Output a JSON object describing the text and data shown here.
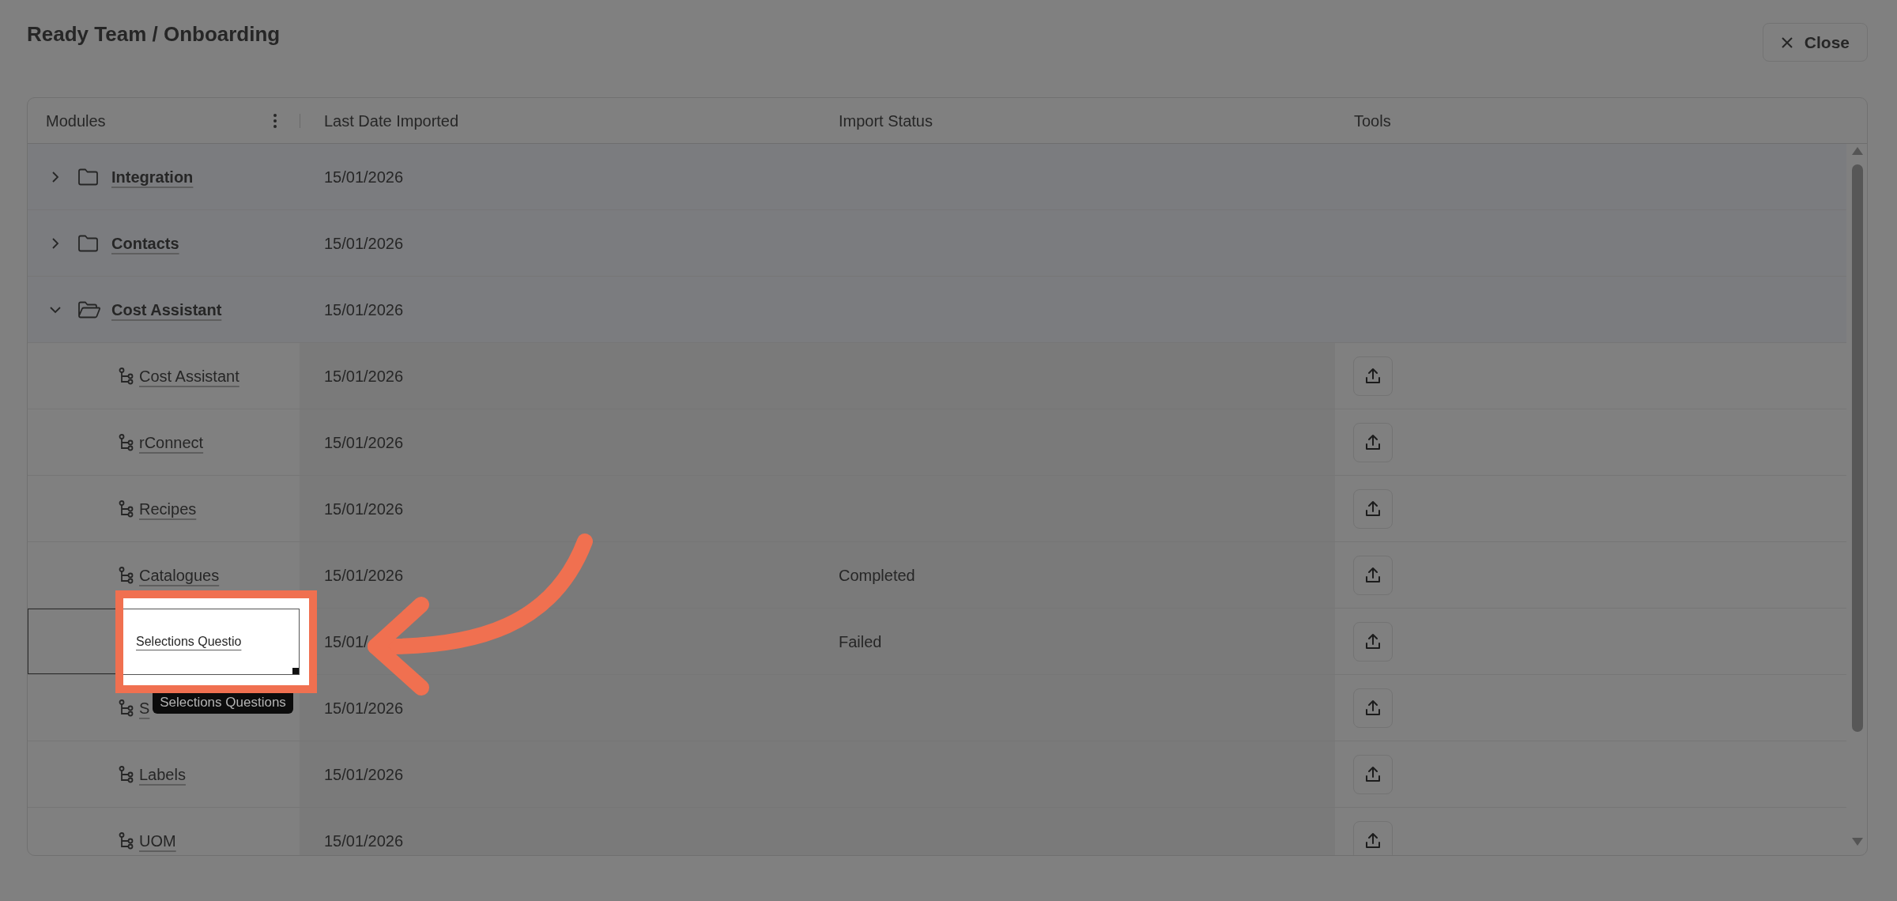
{
  "title": "Ready Team / Onboarding",
  "close_button": "Close",
  "columns": [
    "Modules",
    "Last Date Imported",
    "Import Status",
    "Tools"
  ],
  "rows": [
    {
      "kind": "group",
      "label": "Integration",
      "expanded": false,
      "date": "15/01/2026",
      "selected": false
    },
    {
      "kind": "group",
      "label": "Contacts",
      "expanded": false,
      "date": "15/01/2026",
      "selected": false
    },
    {
      "kind": "group",
      "label": "Cost Assistant",
      "expanded": true,
      "date": "15/01/2026",
      "selected": false
    },
    {
      "kind": "item",
      "label": "Cost Assistant",
      "date": "15/01/2026",
      "selected": false
    },
    {
      "kind": "item",
      "label": "rConnect",
      "date": "15/01/2026",
      "selected": false
    },
    {
      "kind": "item",
      "label": "Recipes",
      "date": "15/01/2026",
      "selected": false
    },
    {
      "kind": "item",
      "label": "Catalogues",
      "date": "15/01/2026",
      "status": "Completed",
      "selected": false
    },
    {
      "kind": "item",
      "label": "Selections Questio",
      "date": "15/01/",
      "status": "Failed",
      "selected": true,
      "tooltip": "Selections Questions"
    },
    {
      "kind": "item",
      "label": "S",
      "date": "15/01/2026",
      "selected": false
    },
    {
      "kind": "item",
      "label": "Labels",
      "date": "15/01/2026",
      "selected": false
    },
    {
      "kind": "item",
      "label": "UOM",
      "date": "15/01/2026",
      "selected": false
    }
  ]
}
